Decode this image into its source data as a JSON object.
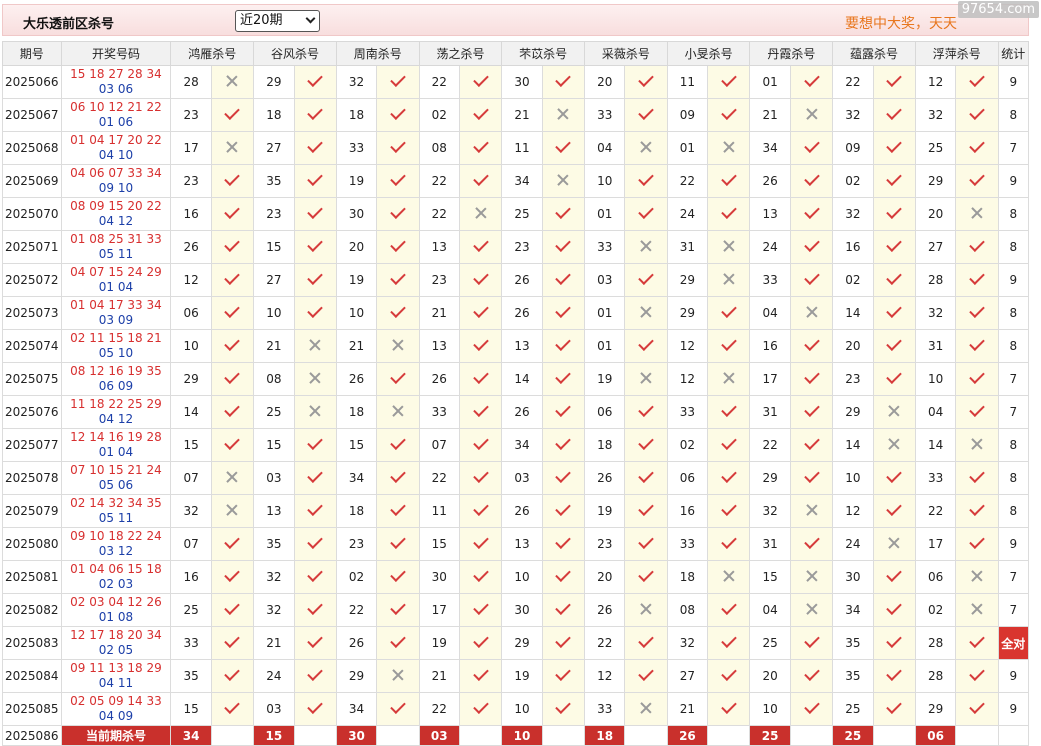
{
  "header": {
    "title": "大乐透前区杀号",
    "period_select": "近20期",
    "slogan": "要想中大奖，天天",
    "watermark": "97654.com"
  },
  "columns": [
    "期号",
    "开奖号码",
    "鸿雁杀号",
    "谷风杀号",
    "周南杀号",
    "荡之杀号",
    "芣苡杀号",
    "采薇杀号",
    "小旻杀号",
    "丹霞杀号",
    "蕴露杀号",
    "浮萍杀号",
    "统计"
  ],
  "rows": [
    {
      "period": "2025066",
      "red": "15 18 27 28 34",
      "blue": "03 06",
      "kills": [
        "28",
        "29",
        "32",
        "22",
        "30",
        "20",
        "11",
        "01",
        "22",
        "12"
      ],
      "hits": [
        0,
        1,
        1,
        1,
        1,
        1,
        1,
        1,
        1,
        1
      ],
      "stat": "9"
    },
    {
      "period": "2025067",
      "red": "06 10 12 21 22",
      "blue": "01 06",
      "kills": [
        "23",
        "18",
        "18",
        "02",
        "21",
        "33",
        "09",
        "21",
        "32",
        "32"
      ],
      "hits": [
        1,
        1,
        1,
        1,
        0,
        1,
        1,
        0,
        1,
        1
      ],
      "stat": "8"
    },
    {
      "period": "2025068",
      "red": "01 04 17 20 22",
      "blue": "04 10",
      "kills": [
        "17",
        "27",
        "33",
        "08",
        "11",
        "04",
        "01",
        "34",
        "09",
        "25"
      ],
      "hits": [
        0,
        1,
        1,
        1,
        1,
        0,
        0,
        1,
        1,
        1
      ],
      "stat": "7"
    },
    {
      "period": "2025069",
      "red": "04 06 07 33 34",
      "blue": "09 10",
      "kills": [
        "23",
        "35",
        "19",
        "22",
        "34",
        "10",
        "22",
        "26",
        "02",
        "29"
      ],
      "hits": [
        1,
        1,
        1,
        1,
        0,
        1,
        1,
        1,
        1,
        1
      ],
      "stat": "9"
    },
    {
      "period": "2025070",
      "red": "08 09 15 20 22",
      "blue": "04 12",
      "kills": [
        "16",
        "23",
        "30",
        "22",
        "25",
        "01",
        "24",
        "13",
        "32",
        "20"
      ],
      "hits": [
        1,
        1,
        1,
        0,
        1,
        1,
        1,
        1,
        1,
        0
      ],
      "stat": "8"
    },
    {
      "period": "2025071",
      "red": "01 08 25 31 33",
      "blue": "05 11",
      "kills": [
        "26",
        "15",
        "20",
        "13",
        "23",
        "33",
        "31",
        "24",
        "16",
        "27"
      ],
      "hits": [
        1,
        1,
        1,
        1,
        1,
        0,
        0,
        1,
        1,
        1
      ],
      "stat": "8"
    },
    {
      "period": "2025072",
      "red": "04 07 15 24 29",
      "blue": "01 04",
      "kills": [
        "12",
        "27",
        "19",
        "23",
        "26",
        "03",
        "29",
        "33",
        "02",
        "28"
      ],
      "hits": [
        1,
        1,
        1,
        1,
        1,
        1,
        0,
        1,
        1,
        1
      ],
      "stat": "9"
    },
    {
      "period": "2025073",
      "red": "01 04 17 33 34",
      "blue": "03 09",
      "kills": [
        "06",
        "10",
        "10",
        "21",
        "26",
        "01",
        "29",
        "04",
        "14",
        "32"
      ],
      "hits": [
        1,
        1,
        1,
        1,
        1,
        0,
        1,
        0,
        1,
        1
      ],
      "stat": "8"
    },
    {
      "period": "2025074",
      "red": "02 11 15 18 21",
      "blue": "05 10",
      "kills": [
        "10",
        "21",
        "21",
        "13",
        "13",
        "01",
        "12",
        "16",
        "20",
        "31"
      ],
      "hits": [
        1,
        0,
        0,
        1,
        1,
        1,
        1,
        1,
        1,
        1
      ],
      "stat": "8"
    },
    {
      "period": "2025075",
      "red": "08 12 16 19 35",
      "blue": "06 09",
      "kills": [
        "29",
        "08",
        "26",
        "26",
        "14",
        "19",
        "12",
        "17",
        "23",
        "10"
      ],
      "hits": [
        1,
        0,
        1,
        1,
        1,
        0,
        0,
        1,
        1,
        1
      ],
      "stat": "7"
    },
    {
      "period": "2025076",
      "red": "11 18 22 25 29",
      "blue": "04 12",
      "kills": [
        "14",
        "25",
        "18",
        "33",
        "26",
        "06",
        "33",
        "31",
        "29",
        "04"
      ],
      "hits": [
        1,
        0,
        0,
        1,
        1,
        1,
        1,
        1,
        0,
        1
      ],
      "stat": "7"
    },
    {
      "period": "2025077",
      "red": "12 14 16 19 28",
      "blue": "01 04",
      "kills": [
        "15",
        "15",
        "15",
        "07",
        "34",
        "18",
        "02",
        "22",
        "14",
        "14"
      ],
      "hits": [
        1,
        1,
        1,
        1,
        1,
        1,
        1,
        1,
        0,
        0
      ],
      "stat": "8"
    },
    {
      "period": "2025078",
      "red": "07 10 15 21 24",
      "blue": "05 06",
      "kills": [
        "07",
        "03",
        "34",
        "22",
        "03",
        "26",
        "06",
        "29",
        "10",
        "33"
      ],
      "hits": [
        0,
        1,
        1,
        1,
        1,
        1,
        1,
        1,
        1,
        1
      ],
      "stat": "8"
    },
    {
      "period": "2025079",
      "red": "02 14 32 34 35",
      "blue": "05 11",
      "kills": [
        "32",
        "13",
        "18",
        "11",
        "26",
        "19",
        "16",
        "32",
        "12",
        "22"
      ],
      "hits": [
        0,
        1,
        1,
        1,
        1,
        1,
        1,
        0,
        1,
        1
      ],
      "stat": "8"
    },
    {
      "period": "2025080",
      "red": "09 10 18 22 24",
      "blue": "03 12",
      "kills": [
        "07",
        "35",
        "23",
        "15",
        "13",
        "23",
        "33",
        "31",
        "24",
        "17"
      ],
      "hits": [
        1,
        1,
        1,
        1,
        1,
        1,
        1,
        1,
        0,
        1
      ],
      "stat": "9"
    },
    {
      "period": "2025081",
      "red": "01 04 06 15 18",
      "blue": "02 03",
      "kills": [
        "16",
        "32",
        "02",
        "30",
        "10",
        "20",
        "18",
        "15",
        "30",
        "06"
      ],
      "hits": [
        1,
        1,
        1,
        1,
        1,
        1,
        0,
        0,
        1,
        0
      ],
      "stat": "7"
    },
    {
      "period": "2025082",
      "red": "02 03 04 12 26",
      "blue": "01 08",
      "kills": [
        "25",
        "32",
        "22",
        "17",
        "30",
        "26",
        "08",
        "04",
        "34",
        "02"
      ],
      "hits": [
        1,
        1,
        1,
        1,
        1,
        0,
        1,
        0,
        1,
        0
      ],
      "stat": "7"
    },
    {
      "period": "2025083",
      "red": "12 17 18 20 34",
      "blue": "02 05",
      "kills": [
        "33",
        "21",
        "26",
        "19",
        "29",
        "22",
        "32",
        "25",
        "35",
        "28"
      ],
      "hits": [
        1,
        1,
        1,
        1,
        1,
        1,
        1,
        1,
        1,
        1
      ],
      "stat": "全对"
    },
    {
      "period": "2025084",
      "red": "09 11 13 18 29",
      "blue": "04 11",
      "kills": [
        "35",
        "24",
        "29",
        "21",
        "19",
        "12",
        "27",
        "20",
        "35",
        "28"
      ],
      "hits": [
        1,
        1,
        0,
        1,
        1,
        1,
        1,
        1,
        1,
        1
      ],
      "stat": "9"
    },
    {
      "period": "2025085",
      "red": "02 05 09 14 33",
      "blue": "04 09",
      "kills": [
        "15",
        "03",
        "34",
        "22",
        "10",
        "33",
        "21",
        "10",
        "25",
        "29"
      ],
      "hits": [
        1,
        1,
        1,
        1,
        1,
        0,
        1,
        1,
        1,
        1
      ],
      "stat": "9"
    }
  ],
  "current": {
    "period": "2025086",
    "label": "当前期杀号",
    "kills": [
      "34",
      "15",
      "30",
      "03",
      "10",
      "18",
      "26",
      "25",
      "25",
      "06"
    ]
  }
}
